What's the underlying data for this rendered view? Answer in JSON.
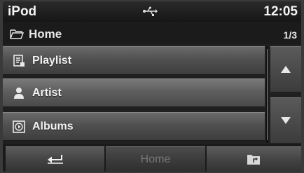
{
  "statusbar": {
    "app_title": "iPod",
    "usb_icon": "usb-icon",
    "clock": "12:05"
  },
  "pathbar": {
    "folder_icon": "folder-open-icon",
    "path": "Home",
    "page": "1/3"
  },
  "list": {
    "items": [
      {
        "label": "Playlist",
        "icon": "playlist-icon"
      },
      {
        "label": "Artist",
        "icon": "artist-icon"
      },
      {
        "label": "Albums",
        "icon": "album-icon"
      }
    ]
  },
  "scroll": {
    "up_icon": "triangle-up-icon",
    "down_icon": "triangle-down-icon"
  },
  "bottombar": {
    "back_icon": "return-arrow-icon",
    "home_label": "Home",
    "home_enabled": false,
    "folder_icon": "folder-up-icon"
  },
  "colors": {
    "background": "#202020",
    "list_item": "#505050",
    "text": "#f0f0f0",
    "disabled_text": "#777777"
  }
}
